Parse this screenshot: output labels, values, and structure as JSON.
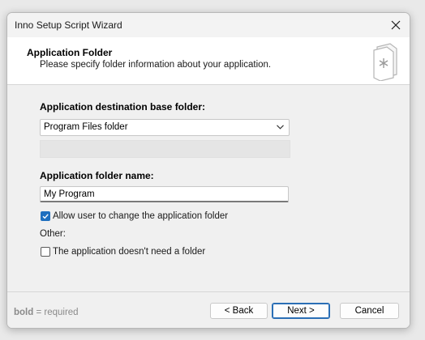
{
  "window": {
    "title": "Inno Setup Script Wizard"
  },
  "header": {
    "title": "Application Folder",
    "subtitle": "Please specify folder information about your application."
  },
  "form": {
    "base_folder_label": "Application destination base folder:",
    "base_folder_value": "Program Files folder",
    "folder_name_label": "Application folder name:",
    "folder_name_value": "My Program",
    "allow_change_label": "Allow user to change the application folder",
    "allow_change_checked": true,
    "other_label": "Other:",
    "no_folder_label": "The application doesn't need a folder",
    "no_folder_checked": false
  },
  "footer": {
    "note_bold": "bold",
    "note_rest": " = required",
    "back_label": "< Back",
    "next_label": "Next >",
    "cancel_label": "Cancel"
  },
  "colors": {
    "accent": "#1f6fbf",
    "primary_button_border": "#2b6fb6"
  },
  "icons": {
    "close": "close-icon",
    "wizard": "wizard-document-icon",
    "dropdown": "chevron-down-icon",
    "check": "check-icon"
  }
}
